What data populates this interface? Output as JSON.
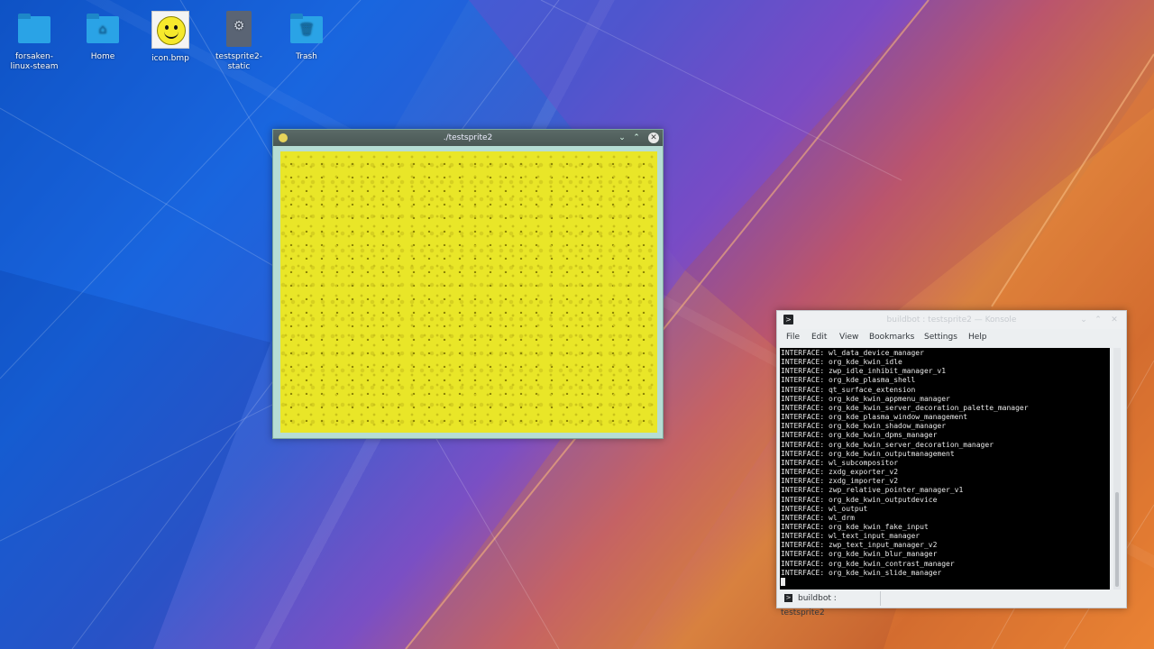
{
  "desktop": {
    "icons": [
      {
        "label": "forsaken-\nlinux-steam",
        "type": "folder-icon"
      },
      {
        "label": "Home",
        "type": "home-folder-icon"
      },
      {
        "label": "icon.bmp",
        "type": "bitmap-smiley-icon"
      },
      {
        "label": "testsprite2-\nstatic",
        "type": "executable-icon"
      },
      {
        "label": "Trash",
        "type": "trash-icon"
      }
    ]
  },
  "sprite_window": {
    "title": "./testsprite2",
    "controls": {
      "minimize": "⌄",
      "maximize": "⌃",
      "close": "✕"
    },
    "canvas_color": "#e9e628"
  },
  "konsole": {
    "title": "buildbot : testsprite2 — Konsole",
    "menu": [
      "File",
      "Edit",
      "View",
      "Bookmarks",
      "Settings",
      "Help"
    ],
    "terminal_lines": [
      "INTERFACE: wl_data_device_manager",
      "INTERFACE: org_kde_kwin_idle",
      "INTERFACE: zwp_idle_inhibit_manager_v1",
      "INTERFACE: org_kde_plasma_shell",
      "INTERFACE: qt_surface_extension",
      "INTERFACE: org_kde_kwin_appmenu_manager",
      "INTERFACE: org_kde_kwin_server_decoration_palette_manager",
      "INTERFACE: org_kde_plasma_window_management",
      "INTERFACE: org_kde_kwin_shadow_manager",
      "INTERFACE: org_kde_kwin_dpms_manager",
      "INTERFACE: org_kde_kwin_server_decoration_manager",
      "INTERFACE: org_kde_kwin_outputmanagement",
      "INTERFACE: wl_subcompositor",
      "INTERFACE: zxdg_exporter_v2",
      "INTERFACE: zxdg_importer_v2",
      "INTERFACE: zwp_relative_pointer_manager_v1",
      "INTERFACE: org_kde_kwin_outputdevice",
      "INTERFACE: wl_output",
      "INTERFACE: wl_drm",
      "INTERFACE: org_kde_kwin_fake_input",
      "INTERFACE: wl_text_input_manager",
      "INTERFACE: zwp_text_input_manager_v2",
      "INTERFACE: org_kde_kwin_blur_manager",
      "INTERFACE: org_kde_kwin_contrast_manager",
      "INTERFACE: org_kde_kwin_slide_manager"
    ],
    "tab_label": "buildbot : testsprite2"
  }
}
